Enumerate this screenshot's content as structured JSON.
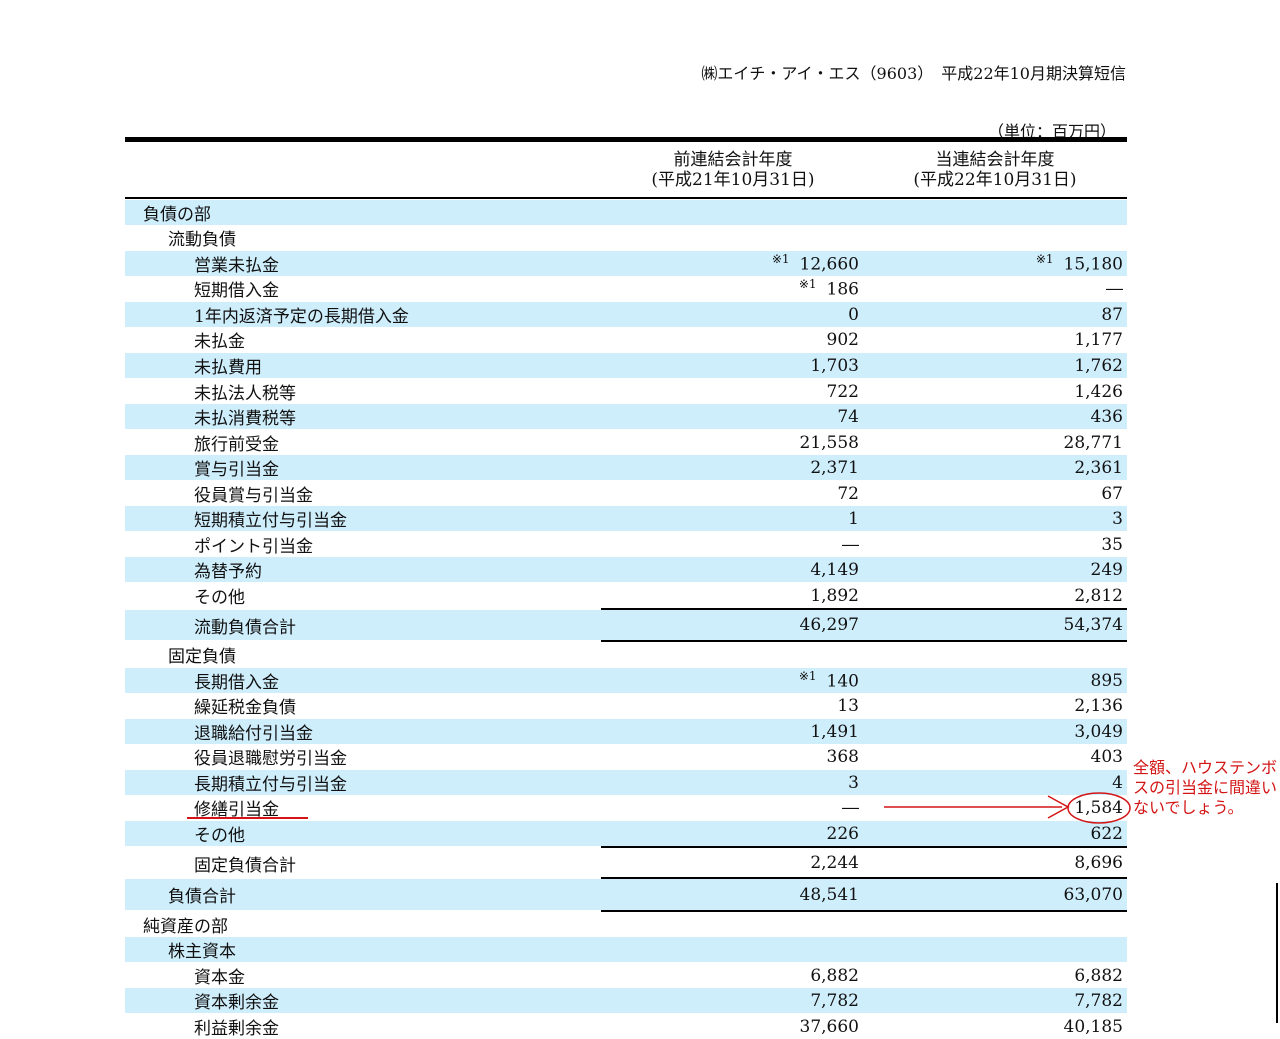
{
  "header": {
    "company": "㈱エイチ・アイ・エス（9603）",
    "doc_title": "平成22年10月期決算短信",
    "unit": "（単位：百万円）"
  },
  "columns": {
    "prev_line1": "前連結会計年度",
    "prev_line2": "(平成21年10月31日)",
    "curr_line1": "当連結会計年度",
    "curr_line2": "(平成22年10月31日)"
  },
  "rows": [
    {
      "label": "負債の部",
      "level": 0,
      "prev": "",
      "curr": "",
      "shade": true
    },
    {
      "label": "流動負債",
      "level": 1,
      "prev": "",
      "curr": "",
      "shade": false
    },
    {
      "label": "営業未払金",
      "level": 2,
      "prev_mark": "※1",
      "prev": "12,660",
      "curr_mark": "※1",
      "curr": "15,180",
      "shade": true
    },
    {
      "label": "短期借入金",
      "level": 2,
      "prev_mark": "※1",
      "prev": "186",
      "curr": "―",
      "shade": false
    },
    {
      "label": "1年内返済予定の長期借入金",
      "level": 2,
      "prev": "0",
      "curr": "87",
      "shade": true
    },
    {
      "label": "未払金",
      "level": 2,
      "prev": "902",
      "curr": "1,177",
      "shade": false
    },
    {
      "label": "未払費用",
      "level": 2,
      "prev": "1,703",
      "curr": "1,762",
      "shade": true
    },
    {
      "label": "未払法人税等",
      "level": 2,
      "prev": "722",
      "curr": "1,426",
      "shade": false
    },
    {
      "label": "未払消費税等",
      "level": 2,
      "prev": "74",
      "curr": "436",
      "shade": true
    },
    {
      "label": "旅行前受金",
      "level": 2,
      "prev": "21,558",
      "curr": "28,771",
      "shade": false
    },
    {
      "label": "賞与引当金",
      "level": 2,
      "prev": "2,371",
      "curr": "2,361",
      "shade": true
    },
    {
      "label": "役員賞与引当金",
      "level": 2,
      "prev": "72",
      "curr": "67",
      "shade": false
    },
    {
      "label": "短期積立付与引当金",
      "level": 2,
      "prev": "1",
      "curr": "3",
      "shade": true
    },
    {
      "label": "ポイント引当金",
      "level": 2,
      "prev": "―",
      "curr": "35",
      "shade": false
    },
    {
      "label": "為替予約",
      "level": 2,
      "prev": "4,149",
      "curr": "249",
      "shade": true
    },
    {
      "label": "その他",
      "level": 2,
      "prev": "1,892",
      "curr": "2,812",
      "shade": false
    },
    {
      "label": "流動負債合計",
      "level": 2,
      "prev": "46,297",
      "curr": "54,374",
      "shade": true,
      "total": true
    },
    {
      "label": "固定負債",
      "level": 1,
      "prev": "",
      "curr": "",
      "shade": false
    },
    {
      "label": "長期借入金",
      "level": 2,
      "prev_mark": "※1",
      "prev": "140",
      "curr": "895",
      "shade": true
    },
    {
      "label": "繰延税金負債",
      "level": 2,
      "prev": "13",
      "curr": "2,136",
      "shade": false
    },
    {
      "label": "退職給付引当金",
      "level": 2,
      "prev": "1,491",
      "curr": "3,049",
      "shade": true
    },
    {
      "label": "役員退職慰労引当金",
      "level": 2,
      "prev": "368",
      "curr": "403",
      "shade": false
    },
    {
      "label": "長期積立付与引当金",
      "level": 2,
      "prev": "3",
      "curr": "4",
      "shade": true
    },
    {
      "label": "修繕引当金",
      "level": 2,
      "prev": "―",
      "curr": "1,584",
      "shade": false
    },
    {
      "label": "その他",
      "level": 2,
      "prev": "226",
      "curr": "622",
      "shade": true
    },
    {
      "label": "固定負債合計",
      "level": 2,
      "prev": "2,244",
      "curr": "8,696",
      "shade": false,
      "total": true
    },
    {
      "label": "負債合計",
      "level": 1,
      "prev": "48,541",
      "curr": "63,070",
      "shade": true,
      "total": true
    },
    {
      "label": "純資産の部",
      "level": 0,
      "prev": "",
      "curr": "",
      "shade": false
    },
    {
      "label": "株主資本",
      "level": 1,
      "prev": "",
      "curr": "",
      "shade": true
    },
    {
      "label": "資本金",
      "level": 2,
      "prev": "6,882",
      "curr": "6,882",
      "shade": false
    },
    {
      "label": "資本剰余金",
      "level": 2,
      "prev": "7,782",
      "curr": "7,782",
      "shade": true
    },
    {
      "label": "利益剰余金",
      "level": 2,
      "prev": "37,660",
      "curr": "40,185",
      "shade": false
    }
  ],
  "annotation": {
    "text": "全額、ハウステンボスの引当金に間違いないでしょう。",
    "color": "#d31515"
  }
}
